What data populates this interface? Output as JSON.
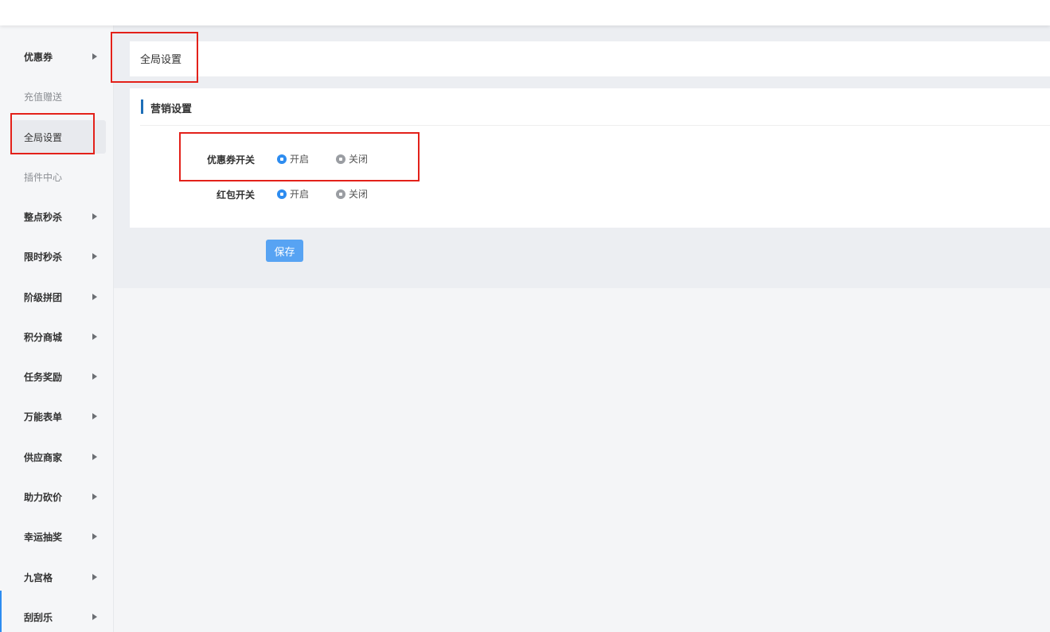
{
  "sidebar": {
    "items": [
      {
        "label": "优惠券",
        "has_arrow": true
      },
      {
        "label": "充值赠送",
        "has_arrow": false
      },
      {
        "label": "全局设置",
        "has_arrow": false,
        "active": true
      },
      {
        "label": "插件中心",
        "has_arrow": false
      },
      {
        "label": "整点秒杀",
        "has_arrow": true
      },
      {
        "label": "限时秒杀",
        "has_arrow": true
      },
      {
        "label": "阶级拼团",
        "has_arrow": true
      },
      {
        "label": "积分商城",
        "has_arrow": true
      },
      {
        "label": "任务奖励",
        "has_arrow": true
      },
      {
        "label": "万能表单",
        "has_arrow": true
      },
      {
        "label": "供应商家",
        "has_arrow": true
      },
      {
        "label": "助力砍价",
        "has_arrow": true
      },
      {
        "label": "幸运抽奖",
        "has_arrow": true
      },
      {
        "label": "九宫格",
        "has_arrow": true
      },
      {
        "label": "刮刮乐",
        "has_arrow": true
      }
    ]
  },
  "header": {
    "title": "全局设置"
  },
  "panel": {
    "title": "营销设置",
    "fields": [
      {
        "label": "优惠券开关",
        "on_label": "开启",
        "off_label": "关闭",
        "selected": "开启"
      },
      {
        "label": "红包开关",
        "on_label": "开启",
        "off_label": "关闭",
        "selected": "开启"
      }
    ]
  },
  "actions": {
    "save_label": "保存"
  },
  "colors": {
    "accent": "#2d8cf0",
    "button": "#57a3f3",
    "highlight": "#e3211a"
  }
}
